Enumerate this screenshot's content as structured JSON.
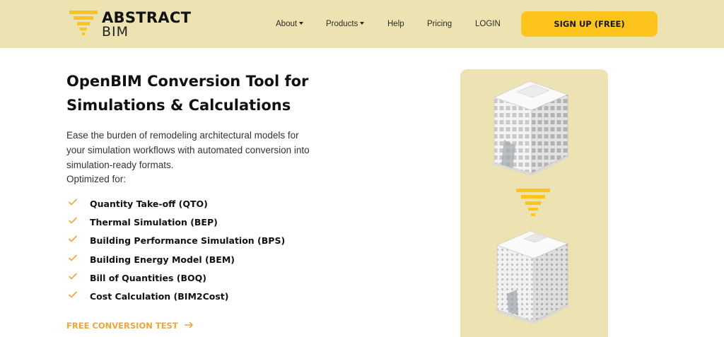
{
  "brand": {
    "line1": "ABSTRACT",
    "line2": "BIM",
    "accent": "#fcc41d"
  },
  "nav": {
    "about": "About",
    "products": "Products",
    "help": "Help",
    "pricing": "Pricing",
    "login": "LOGIN",
    "signup": "SIGN UP (FREE)"
  },
  "hero": {
    "title_line1": "OpenBIM Conversion Tool for",
    "title_line2": "Simulations & Calculations",
    "desc_line1": "Ease the burden of remodeling architectural models for",
    "desc_line2": "your simulation workflows with automated conversion into",
    "desc_line3": "simulation-ready formats.",
    "optimized": "Optimized for:"
  },
  "features": [
    "Quantity Take-off (QTO)",
    "Thermal Simulation (BEP)",
    "Building Performance Simulation (BPS)",
    "Building Energy Model (BEM)",
    "Bill of Quantities (BOQ)",
    "Cost Calculation (BIM2Cost)"
  ],
  "cta": {
    "label": "FREE CONVERSION TEST",
    "color": "#f0a43a"
  },
  "panel": {
    "background": "#ede3b2"
  }
}
